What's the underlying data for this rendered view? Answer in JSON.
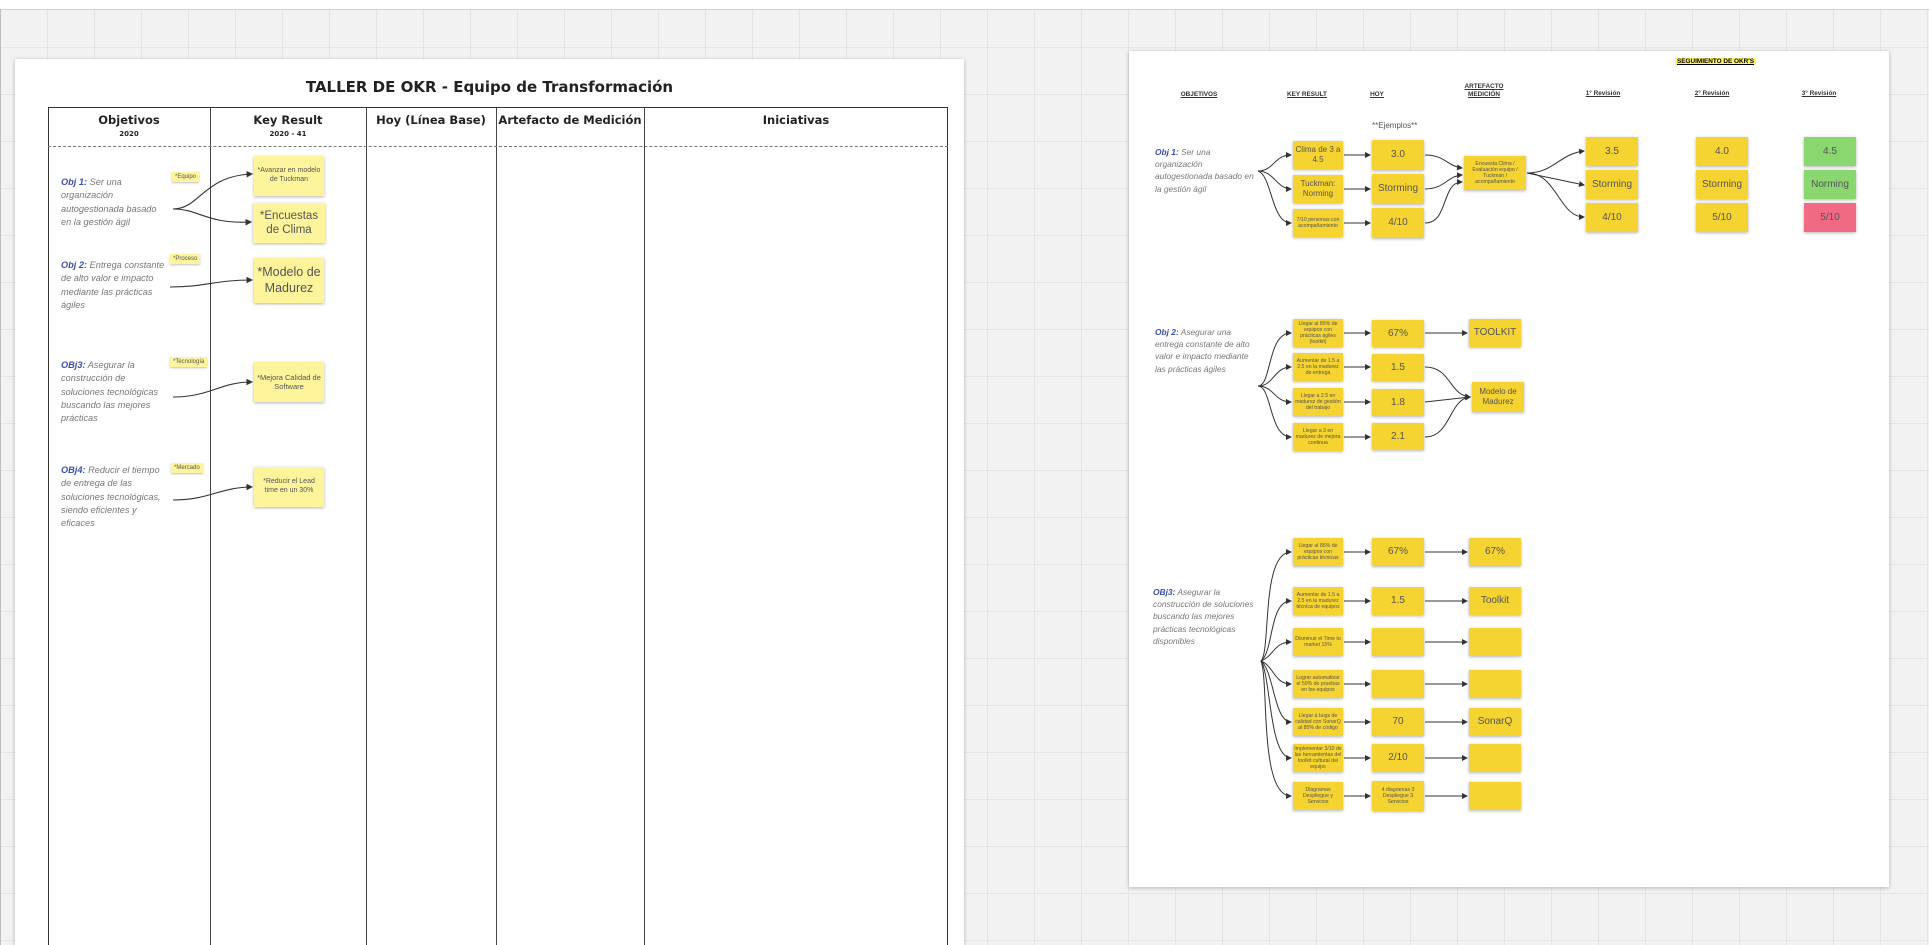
{
  "left_board": {
    "title": "TALLER DE OKR - Equipo de Transformación",
    "columns": [
      {
        "label": "Objetivos",
        "sub": "2020"
      },
      {
        "label": "Key Result",
        "sub": "2020 - 41"
      },
      {
        "label": "Hoy (Línea Base)",
        "sub": ""
      },
      {
        "label": "Artefacto de Medición",
        "sub": ""
      },
      {
        "label": "Iniciativas",
        "sub": ""
      }
    ],
    "objectives": [
      {
        "prefix": "Obj 1:",
        "text": "Ser una organización autogestionada basado en la gestión ágil",
        "tag": "*Equipo"
      },
      {
        "prefix": "Obj 2:",
        "text": "Entrega constante de alto valor e impacto mediante las prácticas ágiles",
        "tag": "*Proceso"
      },
      {
        "prefix": "OBj3:",
        "text": "Asegurar la construcción de soluciones tecnológicas buscando las mejores prácticas",
        "tag": "*Tecnología"
      },
      {
        "prefix": "OBj4:",
        "text": "Reducir el tiempo de entrega de las soluciones tecnológicas, siendo eficientes y eficaces",
        "tag": "*Mercado"
      }
    ],
    "key_results": [
      "*Avanzar en modelo de Tuckman",
      "*Encuestas de Clima",
      "*Modelo de Madurez",
      "*Mejora Calidad de Software",
      "*Reducir el Lead time en un 30%"
    ]
  },
  "right_board": {
    "headers": {
      "objetivos": "OBJETIVOS",
      "key_result": "KEY RESULT",
      "hoy": "HOY",
      "artefacto": "ARTEFACTO MEDICIÓN",
      "seguimiento": "SEGUIMIENTO DE OKR'S",
      "rev1": "1° Revisión",
      "rev2": "2° Revisión",
      "rev3": "3° Revisión"
    },
    "ejemplos": "**Ejemplos**",
    "obj1": {
      "prefix": "Obj 1:",
      "text": "Ser una organización autogestionada basado en la gestión ágil",
      "krs": [
        "Clima de 3 a 4.5",
        "Tuckman: Norming",
        "7/10 personas con acompañamiento"
      ],
      "hoy": [
        "3.0",
        "Storming",
        "4/10"
      ],
      "artefacto": "Encuesta Clima / Evaluación equipo / Tuckman / acompañamiento",
      "rev1": [
        "3.5",
        "Storming",
        "4/10"
      ],
      "rev2": [
        "4.0",
        "Storming",
        "5/10"
      ],
      "rev3": [
        "4.5",
        "Norming",
        "5/10"
      ]
    },
    "obj2": {
      "prefix": "Obj 2:",
      "text": "Asegurar una entrega constante de alto valor e impacto mediante las prácticas ágiles",
      "krs": [
        "Llegar al 85% de equipos con prácticas ágiles (toolkit)",
        "Aumentar de 1.5 a 2.5 en la madurez de entrega",
        "Llegar a 2.5 en madurez de gestión del trabajo",
        "Llegar a 3 en madurez de mejora continua"
      ],
      "hoy": [
        "67%",
        "1.5",
        "1.8",
        "2.1"
      ],
      "artefactos": [
        "TOOLKIT",
        "Modelo de Madurez"
      ]
    },
    "obj3": {
      "prefix": "OBj3:",
      "text": "Asegurar la construcción de soluciones buscando las mejores prácticas tecnológicas disponibles",
      "krs": [
        "Llegar al 85% de equipos con prácticas técnicas",
        "Aumentar de 1.5 a 2.5 en la madurez técnica de equipos",
        "Disminuir el Time to market 15%",
        "Lograr automatizar el 50% de pruebas en los equipos",
        "Llegar a bugs de calidad con SonarQ al 85% de código",
        "Implementar 3/10 de las herramientas del toolkit cultural del equipo",
        "Diagramas Despliegue y Servicios"
      ],
      "hoy": [
        "67%",
        "1.5",
        "",
        "",
        "70",
        "2/10",
        "4 diagramas 3 Despliegue 3 Servicios"
      ],
      "artefactos": [
        "67%",
        "Toolkit",
        "",
        "",
        "SonarQ",
        "",
        ""
      ]
    }
  }
}
